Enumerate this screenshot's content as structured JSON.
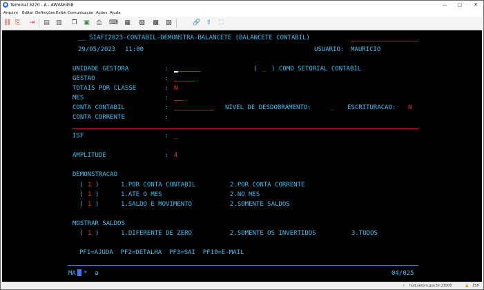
{
  "window": {
    "title": "Terminal 3270 - A - AWVAE458",
    "controls": {
      "minimize": "—",
      "maximize": "▢",
      "close": "✕"
    }
  },
  "menu": [
    "Arquivo",
    "Editar",
    "Definições",
    "Exibir",
    "Comunicação",
    "Ações",
    "Ajuda"
  ],
  "toolbar": {
    "icons": [
      "disconnect-icon",
      "connect-icon",
      "exit-icon",
      "send-icon",
      "receive-icon",
      "copy-icon",
      "paste-icon",
      "print-icon",
      "keyboard-icon",
      "macro-play-icon",
      "macro-record-icon",
      "macro-stop-icon",
      "link-icon",
      "upload-icon",
      "fullscreen-icon"
    ]
  },
  "screen": {
    "header_title": "__ SIAFI2023-CONTABIL-DEMONSTRA-BALANCETE (BALANCETE CONTABIL)",
    "date": "29/05/2023",
    "time": "11:00",
    "user_label": "USUARIO:",
    "user_name": "MAURICIO",
    "fields": {
      "unidade_gestora": {
        "label": "UNIDADE GESTORA",
        "sep": ":",
        "value": ""
      },
      "setorial": {
        "prefix": "(",
        "value": "_",
        "suffix": ")",
        "label": "COMO SETORIAL CONTABIL"
      },
      "gestao": {
        "label": "GESTAO",
        "sep": ":"
      },
      "totais_por_classe": {
        "label": "TOTAIS POR CLASSE",
        "sep": ":",
        "value": "N"
      },
      "mes": {
        "label": "MES",
        "sep": ":"
      },
      "conta_contabil": {
        "label": "CONTA CONTABIL",
        "sep": ":"
      },
      "nivel": {
        "label": "NIVEL DE DESDOBRAMENTO:",
        "value": "_"
      },
      "escrituracao": {
        "label": "ESCRITURACAO:",
        "value": "N"
      },
      "conta_corrente": {
        "label": "CONTA CORRENTE",
        "sep": ":"
      },
      "isf": {
        "label": "ISF",
        "sep": ":",
        "value": "_"
      },
      "amplitude": {
        "label": "AMPLITUDE",
        "sep": ":",
        "value": "4"
      }
    },
    "demonstracao": {
      "heading": "DEMONSTRACAO",
      "rows": [
        {
          "open": "(",
          "value": "1",
          "close": ")",
          "opt1": "1.POR CONTA CONTABIL",
          "opt2": "2.POR CONTA CORRENTE"
        },
        {
          "open": "(",
          "value": "1",
          "close": ")",
          "opt1": "1.ATE O MES",
          "opt2": "2.NO MES"
        },
        {
          "open": "(",
          "value": "1",
          "close": ")",
          "opt1": "1.SALDO E MOVIMENTO",
          "opt2": "2.SOMENTE SALDOS"
        }
      ]
    },
    "mostrar_saldos": {
      "heading": "MOSTRAR SALDOS",
      "open": "(",
      "value": "1",
      "close": ")",
      "opt1": "1.DIFERENTE DE ZERO",
      "opt2": "2.SOMENTE OS INVERTIDOS",
      "opt3": "3.TODOS"
    },
    "pf_keys": "PF1=AJUDA  PF2=DETALHA  PF3=SAI  PF10=E-MAIL",
    "oia_left": "MA",
    "oia_mid": "*  a",
    "oia_right": "04/025"
  },
  "status": {
    "host": "hod.serpro.gov.br:23000",
    "port": "158"
  }
}
